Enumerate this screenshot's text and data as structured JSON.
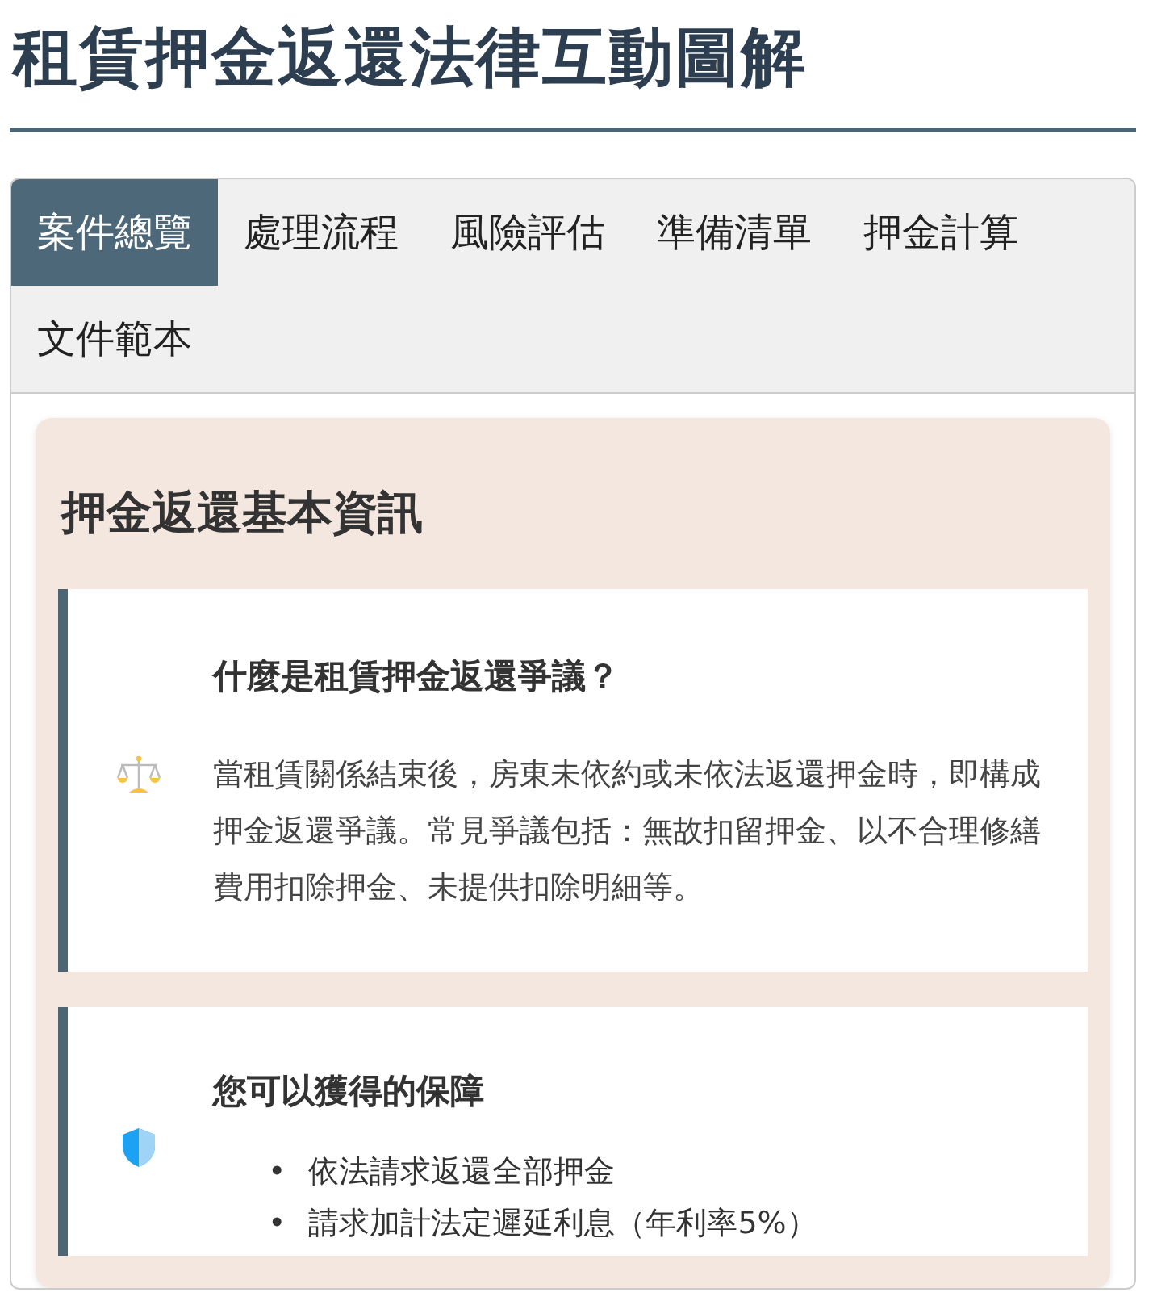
{
  "title": "租賃押金返還法律互動圖解",
  "tabs": [
    {
      "label": "案件總覽",
      "selected": true
    },
    {
      "label": "處理流程",
      "selected": false
    },
    {
      "label": "風險評估",
      "selected": false
    },
    {
      "label": "準備清單",
      "selected": false
    },
    {
      "label": "押金計算",
      "selected": false
    },
    {
      "label": "文件範本",
      "selected": false
    }
  ],
  "section": {
    "heading": "押金返還基本資訊",
    "cards": [
      {
        "kind": "paragraph",
        "title": "什麼是租賃押金返還爭議？",
        "text": "當租賃關係結束後，房東未依約或未依法返還押金時，即構成押金返還爭議。常見爭議包括：無故扣留押金、以不合理修繕費用扣除押金、未提供扣除明細等。"
      },
      {
        "kind": "list",
        "title": "您可以獲得的保障",
        "bullet": "•",
        "items": [
          "依法請求返還全部押金",
          "請求加計法定遲延利息（年利率5%）"
        ]
      }
    ]
  }
}
